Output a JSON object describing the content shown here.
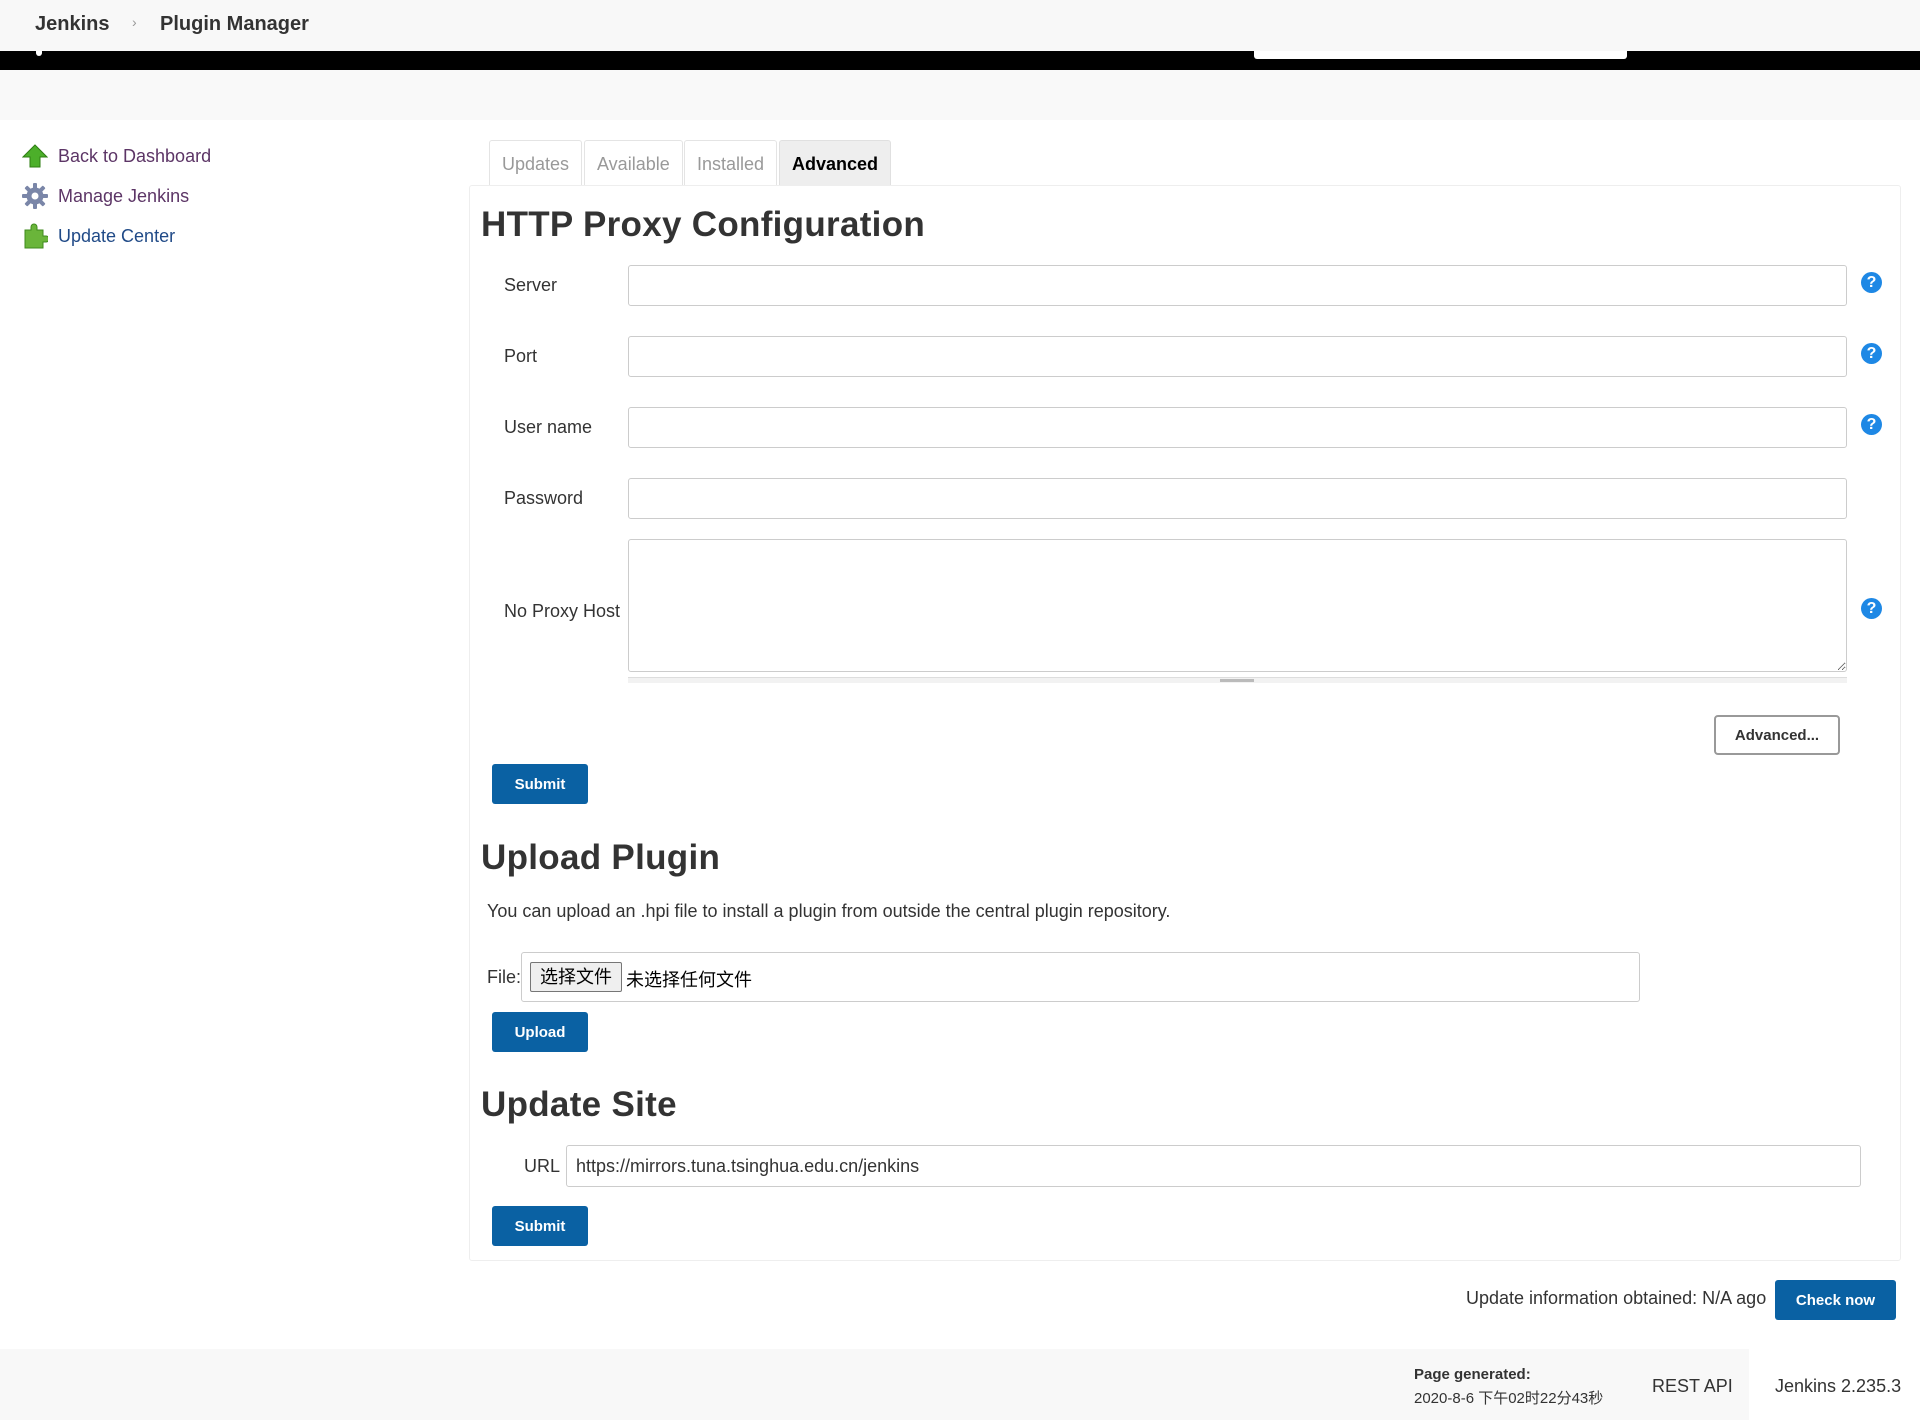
{
  "breadcrumb": {
    "items": [
      "Jenkins",
      "Plugin Manager"
    ],
    "separator": "›"
  },
  "sidebar": {
    "items": [
      {
        "label": "Back to Dashboard",
        "icon": "up-arrow-icon"
      },
      {
        "label": "Manage Jenkins",
        "icon": "gear-icon"
      },
      {
        "label": "Update Center",
        "icon": "puzzle-icon"
      }
    ]
  },
  "tabs": [
    {
      "label": "Updates",
      "active": false
    },
    {
      "label": "Available",
      "active": false
    },
    {
      "label": "Installed",
      "active": false
    },
    {
      "label": "Advanced",
      "active": true
    }
  ],
  "proxy": {
    "title": "HTTP Proxy Configuration",
    "fields": {
      "server": {
        "label": "Server",
        "value": ""
      },
      "port": {
        "label": "Port",
        "value": ""
      },
      "username": {
        "label": "User name",
        "value": ""
      },
      "password": {
        "label": "Password",
        "value": ""
      },
      "no_proxy_host": {
        "label": "No Proxy Host",
        "value": ""
      }
    },
    "help_glyph": "?",
    "advanced_label": "Advanced...",
    "submit_label": "Submit"
  },
  "upload": {
    "title": "Upload Plugin",
    "description": "You can upload an .hpi file to install a plugin from outside the central plugin repository.",
    "file_label": "File:",
    "choose_button": "选择文件",
    "no_file_text": "未选择任何文件",
    "upload_label": "Upload"
  },
  "update_site": {
    "title": "Update Site",
    "url_label": "URL",
    "url_value": "https://mirrors.tuna.tsinghua.edu.cn/jenkins",
    "submit_label": "Submit"
  },
  "update_info": {
    "text": "Update information obtained: N/A ago",
    "check_now_label": "Check now"
  },
  "footer": {
    "page_generated_label": "Page generated:",
    "page_generated_value": "2020-8-6 下午02时22分43秒",
    "rest_api": "REST API",
    "version": "Jenkins 2.235.3"
  },
  "colors": {
    "primary_button": "#0a61a3",
    "help_icon": "#1e88e5",
    "sidebar_link": "#5c3566"
  }
}
